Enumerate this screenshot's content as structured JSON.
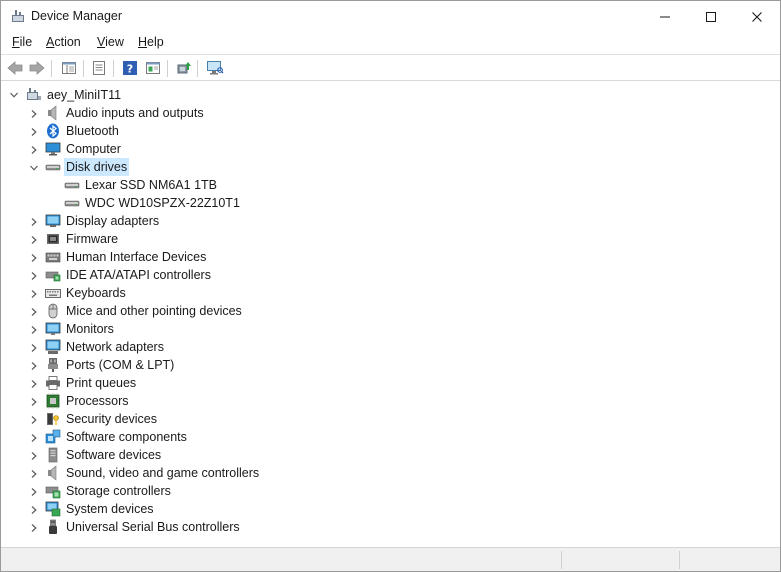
{
  "window": {
    "title": "Device Manager"
  },
  "menu": {
    "items": [
      {
        "label_u": "F",
        "label_rest": "ile"
      },
      {
        "label_u": "A",
        "label_rest": "ction"
      },
      {
        "label_u": "V",
        "label_rest": "iew"
      },
      {
        "label_u": "H",
        "label_rest": "elp"
      }
    ]
  },
  "toolbar": {
    "buttons": [
      "back-icon",
      "forward-icon",
      "show-hide-console-tree-icon",
      "properties-icon",
      "help-icon",
      "view-icon",
      "update-driver-icon",
      "scan-hardware-icon"
    ]
  },
  "tree": {
    "root": "aey_MiniIT11",
    "categories": [
      {
        "label": "Audio inputs and outputs",
        "icon": "speaker-icon",
        "expanded": false
      },
      {
        "label": "Bluetooth",
        "icon": "bluetooth-icon",
        "expanded": false
      },
      {
        "label": "Computer",
        "icon": "computer-icon",
        "expanded": false
      },
      {
        "label": "Disk drives",
        "icon": "disk-drive-icon",
        "expanded": true,
        "selected": true,
        "children": [
          "Lexar SSD NM6A1 1TB",
          "WDC WD10SPZX-22Z10T1"
        ]
      },
      {
        "label": "Display adapters",
        "icon": "display-adapter-icon",
        "expanded": false
      },
      {
        "label": "Firmware",
        "icon": "firmware-icon",
        "expanded": false
      },
      {
        "label": "Human Interface Devices",
        "icon": "hid-icon",
        "expanded": false
      },
      {
        "label": "IDE ATA/ATAPI controllers",
        "icon": "ide-controller-icon",
        "expanded": false
      },
      {
        "label": "Keyboards",
        "icon": "keyboard-icon",
        "expanded": false
      },
      {
        "label": "Mice and other pointing devices",
        "icon": "mouse-icon",
        "expanded": false
      },
      {
        "label": "Monitors",
        "icon": "monitor-icon",
        "expanded": false
      },
      {
        "label": "Network adapters",
        "icon": "network-adapter-icon",
        "expanded": false
      },
      {
        "label": "Ports (COM & LPT)",
        "icon": "port-icon",
        "expanded": false
      },
      {
        "label": "Print queues",
        "icon": "printer-icon",
        "expanded": false
      },
      {
        "label": "Processors",
        "icon": "processor-icon",
        "expanded": false
      },
      {
        "label": "Security devices",
        "icon": "security-device-icon",
        "expanded": false
      },
      {
        "label": "Software components",
        "icon": "software-component-icon",
        "expanded": false
      },
      {
        "label": "Software devices",
        "icon": "software-device-icon",
        "expanded": false
      },
      {
        "label": "Sound, video and game controllers",
        "icon": "sound-controller-icon",
        "expanded": false
      },
      {
        "label": "Storage controllers",
        "icon": "storage-controller-icon",
        "expanded": false
      },
      {
        "label": "System devices",
        "icon": "system-device-icon",
        "expanded": false
      },
      {
        "label": "Universal Serial Bus controllers",
        "icon": "usb-icon",
        "expanded": false
      }
    ]
  },
  "colors": {
    "selection": "#cce8ff",
    "chevron": "#5a5a5a"
  }
}
